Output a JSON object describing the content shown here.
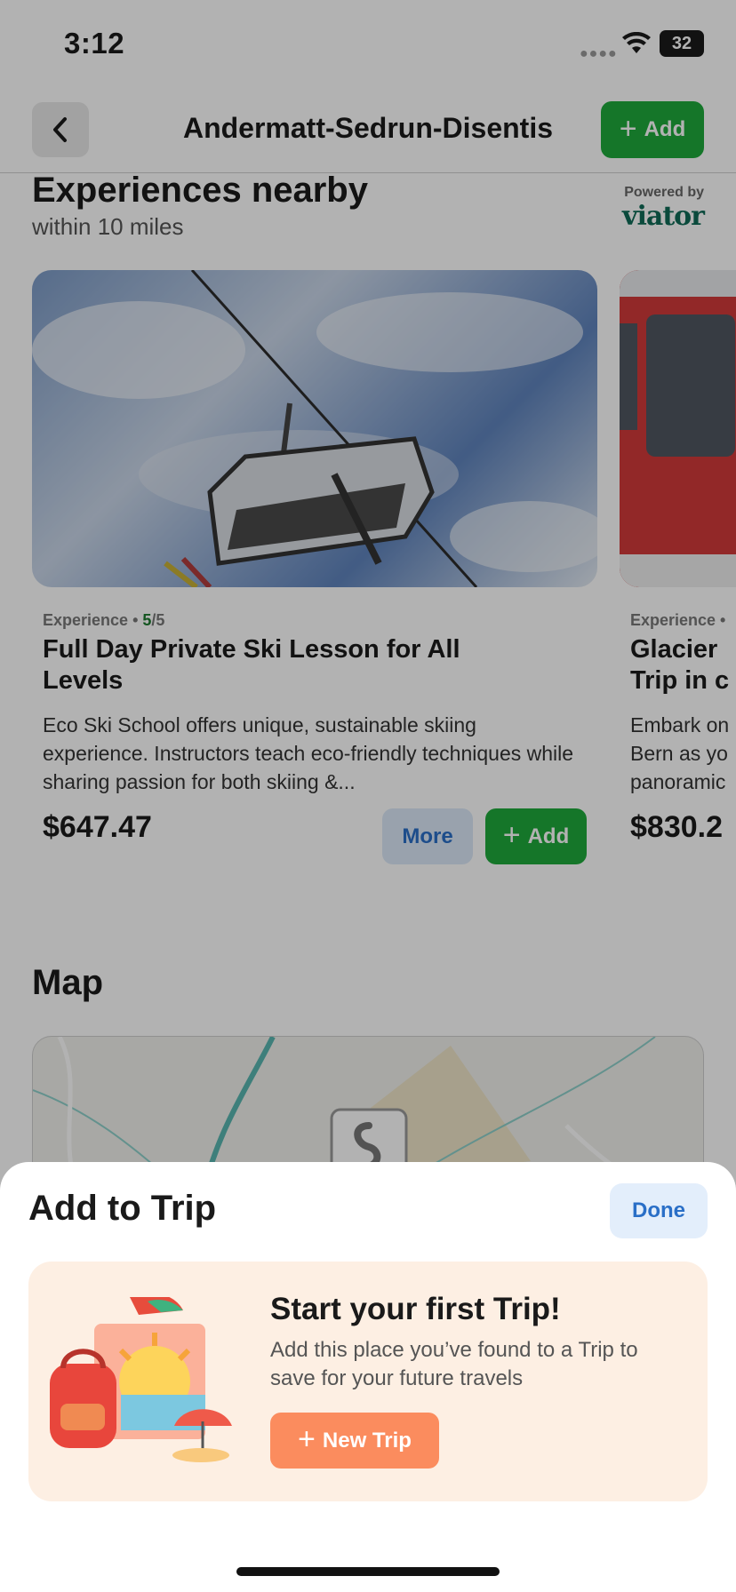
{
  "status_bar": {
    "time": "3:12",
    "battery": "32"
  },
  "nav": {
    "title": "Andermatt-Sedrun-Disentis",
    "add_label": "Add"
  },
  "experiences": {
    "title": "Experiences nearby",
    "subtitle": "within 10 miles",
    "powered_by": "Powered by",
    "brand": "viator",
    "cards": [
      {
        "category": "Experience",
        "rating": "5",
        "rating_max": "/5",
        "title": "Full Day Private Ski Lesson for All Levels",
        "description": "Eco Ski School offers unique, sustainable skiing experience. Instructors teach eco-friendly techniques while sharing passion for both skiing &...",
        "price": "$647.47",
        "more_label": "More",
        "add_label": "Add"
      },
      {
        "category": "Experience •",
        "title_line1": "Glacier",
        "title_line2": "Trip in c",
        "desc_line1": "Embark on",
        "desc_line2": "Bern as yo",
        "desc_line3": "panoramic",
        "price": "$830.2"
      }
    ]
  },
  "map": {
    "title": "Map"
  },
  "sheet": {
    "title": "Add to Trip",
    "done_label": "Done",
    "promo_title": "Start your first Trip!",
    "promo_text": "Add this place you’ve found to a Trip to save for your future travels",
    "new_trip_label": "New Trip"
  },
  "colors": {
    "green": "#1faa3c",
    "blue": "#2a6fc7",
    "orange": "#fb8c5e",
    "promo_bg": "#fdefe3"
  }
}
